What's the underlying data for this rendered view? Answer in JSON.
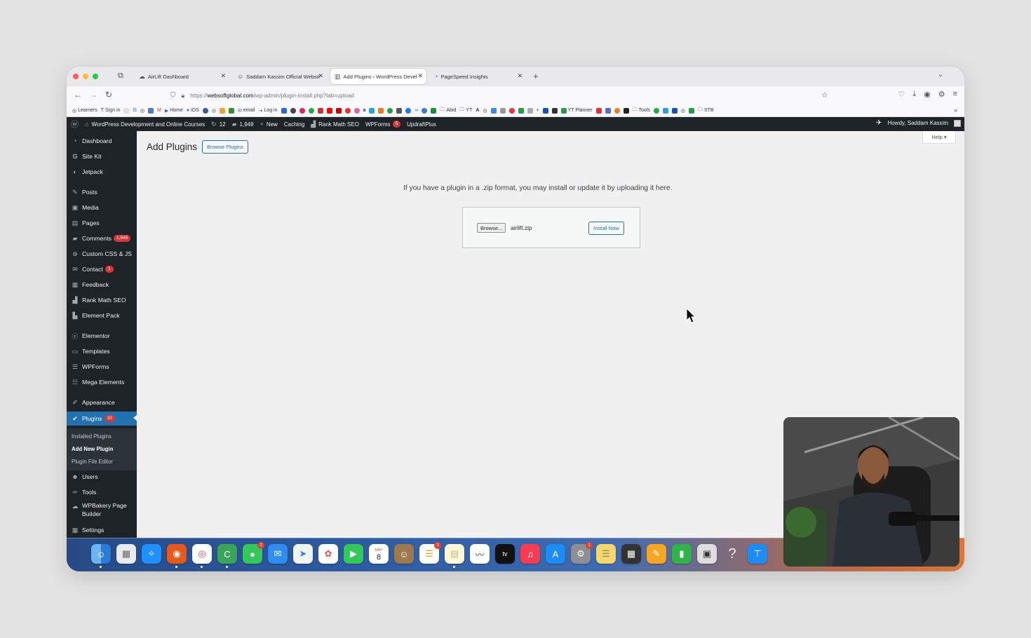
{
  "browser": {
    "tabs": [
      {
        "label": "AirLift Dashboard",
        "active": false
      },
      {
        "label": "Saddam Kassim Official Websit",
        "active": false
      },
      {
        "label": "Add Plugins ‹ WordPress Devel",
        "active": true
      },
      {
        "label": "PageSpeed Insights",
        "active": false
      }
    ],
    "url_prefix": "https://",
    "url_domain": "websoftglobal.com",
    "url_path": "/wp-admin/plugin-install.php?tab=upload",
    "bookmarks": [
      "Learners",
      "Sign in",
      "Home",
      "iOS",
      "email",
      "Log in",
      "Abid",
      "YT",
      "YT Planner",
      "Tools",
      "STB"
    ]
  },
  "admin_bar": {
    "site_name": "WordPress Development and Online Courses",
    "updates_count": "12",
    "comments_count": "1,948",
    "new_label": "New",
    "caching_label": "Caching",
    "rankmath_label": "Rank Math SEO",
    "wpforms_label": "WPForms",
    "wpforms_badge": "5",
    "updraft_label": "UpdraftPlus",
    "howdy": "Howdy, Saddam Kassim"
  },
  "sidebar": {
    "items": [
      {
        "label": "Dashboard",
        "icon": "dashboard-icon"
      },
      {
        "label": "Site Kit",
        "icon": "sitekit-icon"
      },
      {
        "label": "Jetpack",
        "icon": "jetpack-icon"
      },
      {
        "label": "Posts",
        "icon": "pin-icon"
      },
      {
        "label": "Media",
        "icon": "media-icon"
      },
      {
        "label": "Pages",
        "icon": "pages-icon"
      },
      {
        "label": "Comments",
        "icon": "comment-icon",
        "badge": "1,948"
      },
      {
        "label": "Custom CSS & JS",
        "icon": "plus-icon"
      },
      {
        "label": "Contact",
        "icon": "mail-icon",
        "badge": "1"
      },
      {
        "label": "Feedback",
        "icon": "feedback-icon"
      },
      {
        "label": "Rank Math SEO",
        "icon": "chart-icon"
      },
      {
        "label": "Element Pack",
        "icon": "element-pack-icon"
      },
      {
        "label": "Elementor",
        "icon": "elementor-icon"
      },
      {
        "label": "Templates",
        "icon": "folder-icon"
      },
      {
        "label": "WPForms",
        "icon": "form-icon"
      },
      {
        "label": "Mega Elements",
        "icon": "mega-icon"
      },
      {
        "label": "Appearance",
        "icon": "brush-icon"
      },
      {
        "label": "Plugins",
        "icon": "plugin-icon",
        "badge": "10",
        "current": true
      },
      {
        "label": "Users",
        "icon": "user-icon"
      },
      {
        "label": "Tools",
        "icon": "wrench-icon"
      },
      {
        "label": "WPBakery Page Builder",
        "icon": "cloud-icon"
      },
      {
        "label": "Settings",
        "icon": "settings-icon"
      }
    ],
    "submenu": [
      "Installed Plugins",
      "Add New Plugin",
      "Plugin File Editor"
    ]
  },
  "main": {
    "title": "Add Plugins",
    "browse_plugins": "Browse Plugins",
    "help": "Help ▾",
    "upload_message": "If you have a plugin in a .zip format, you may install or update it by uploading it here.",
    "browse_button": "Browse...",
    "file_name": "airlift.zip",
    "install_now": "Install Now"
  },
  "dock": {
    "calendar_month": "MAY",
    "calendar_day": "8",
    "messages_badge": "2",
    "reminders_badge": "3",
    "settings_badge": "1"
  },
  "colors": {
    "admin_dark": "#1d2327",
    "wp_blue": "#2271b1",
    "badge_red": "#d63638",
    "content_bg": "#f0f0f1"
  }
}
